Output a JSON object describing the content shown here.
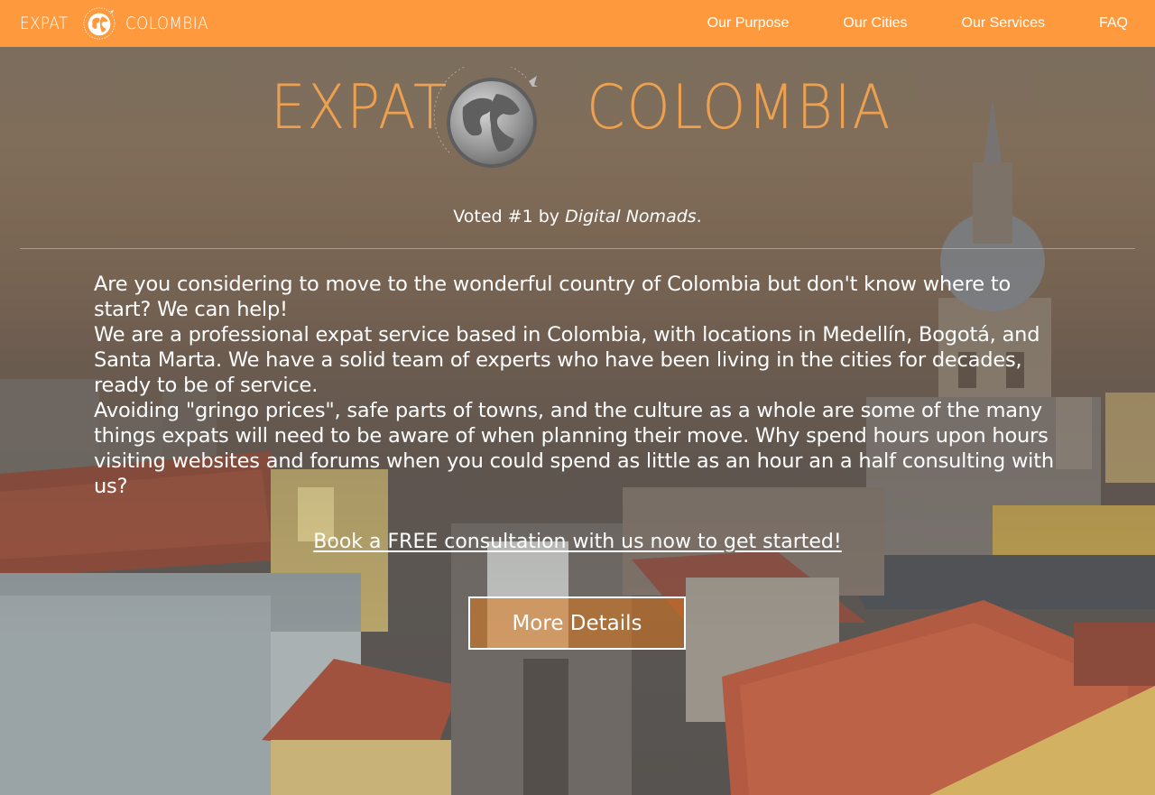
{
  "colors": {
    "nav_bg": "#fe9a3d",
    "accent": "#f7a650",
    "text": "#ffffff"
  },
  "nav": {
    "brand_left": "EXPAT",
    "brand_right": "COLOMBIA",
    "links": [
      {
        "label": "Our Purpose"
      },
      {
        "label": "Our Cities"
      },
      {
        "label": "Our Services"
      },
      {
        "label": "FAQ"
      }
    ]
  },
  "hero": {
    "logo_left": "EXPAT",
    "logo_right": "COLOMBIA",
    "voted_prefix": "Voted #1 by ",
    "voted_emph": "Digital Nomads",
    "voted_suffix": ".",
    "paragraphs": [
      "Are you considering to move to the wonderful country of Colombia but don't know where to start? We can help!",
      "We are a professional expat service based in Colombia, with locations in Medellín, Bogotá, and Santa Marta. We have a solid team of experts who have been living in the cities for decades, ready to be of service.",
      "Avoiding \"gringo prices\", safe parts of towns, and the culture as a whole are some of the many things expats will need to be aware of when planning their move. Why spend hours upon hours visiting websites and forums when you could spend as little as an hour an a half consulting with us?"
    ],
    "cta_link": "Book a FREE consultation with us now to get started!",
    "more_button": "More Details"
  }
}
